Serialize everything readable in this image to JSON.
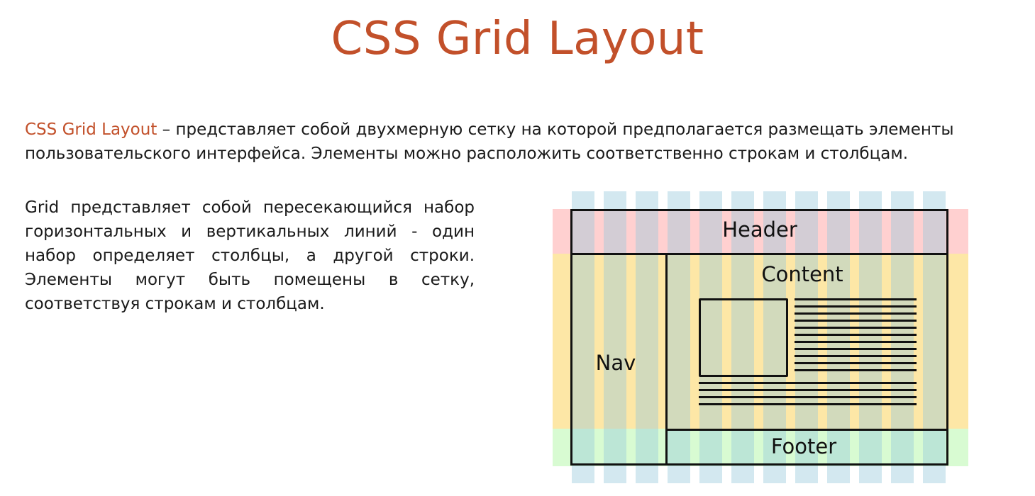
{
  "title": "CSS Grid Layout",
  "intro": {
    "term": "CSS Grid Layout",
    "text": " – представляет собой двухмерную сетку на которой предполагается размещать элементы пользовательского интерфейса. Элементы можно расположить соответственно строкам и столбцам."
  },
  "description": "Grid представляет собой пересекающийся набор горизонтальных и вертикальных линий - один набор определяет столбцы, а другой строки. Элементы могут быть помещены в сетку, соответствуя строкам и столбцам.",
  "diagram": {
    "header_label": "Header",
    "content_label": "Content",
    "nav_label": "Nav",
    "footer_label": "Footer",
    "colors": {
      "header_band": "#ffd0d0",
      "middle_band": "#fde7a6",
      "footer_band": "#d8fbd2",
      "grid_columns": "#9ccbd8",
      "lines": "#111111"
    }
  }
}
